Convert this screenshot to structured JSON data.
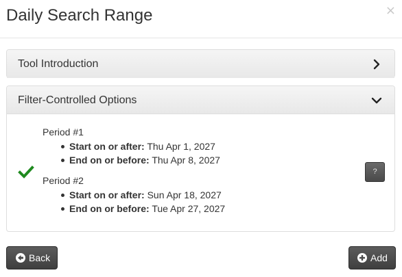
{
  "modal": {
    "title": "Daily Search Range",
    "close_symbol": "×"
  },
  "panels": {
    "intro": {
      "title": "Tool Introduction",
      "icon": "chevron-right-icon",
      "expanded": false
    },
    "filter": {
      "title": "Filter-Controlled Options",
      "icon": "chevron-down-icon",
      "expanded": true
    }
  },
  "periods": [
    {
      "label": "Period #1",
      "start_label": "Start on or after:",
      "start_value": "Thu Apr 1, 2027",
      "end_label": "End on or before:",
      "end_value": "Thu Apr 8, 2027"
    },
    {
      "label": "Period #2",
      "start_label": "Start on or after:",
      "start_value": "Sun Apr 18, 2027",
      "end_label": "End on or before:",
      "end_value": "Tue Apr 27, 2027"
    }
  ],
  "help_button": {
    "label": "?"
  },
  "footer": {
    "back_label": "Back",
    "add_label": "Add"
  },
  "colors": {
    "check": "#1f8a1f",
    "button_dark": "#4a4a4a",
    "panel_heading": "#eeeeee"
  }
}
